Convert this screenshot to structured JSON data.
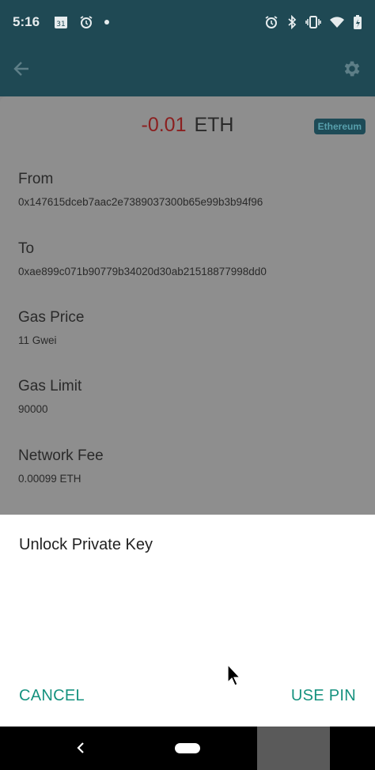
{
  "status_bar": {
    "time": "5:16",
    "calendar_day": "31"
  },
  "transaction": {
    "amount": "-0.01",
    "currency": "ETH",
    "network": "Ethereum",
    "fields": [
      {
        "label": "From",
        "value": "0x147615dceb7aac2e7389037300b65e99b3b94f96"
      },
      {
        "label": "To",
        "value": "0xae899c071b90779b34020d30ab21518877998dd0"
      },
      {
        "label": "Gas Price",
        "value": "11 Gwei"
      },
      {
        "label": "Gas Limit",
        "value": "90000"
      },
      {
        "label": "Network Fee",
        "value": "0.00099 ETH"
      }
    ]
  },
  "dialog": {
    "title": "Unlock Private Key",
    "cancel_label": "CANCEL",
    "use_pin_label": "USE PIN"
  },
  "colors": {
    "app_bar": "#1f4954",
    "accent": "#16927f",
    "amount_negative": "#8b1f1f"
  }
}
